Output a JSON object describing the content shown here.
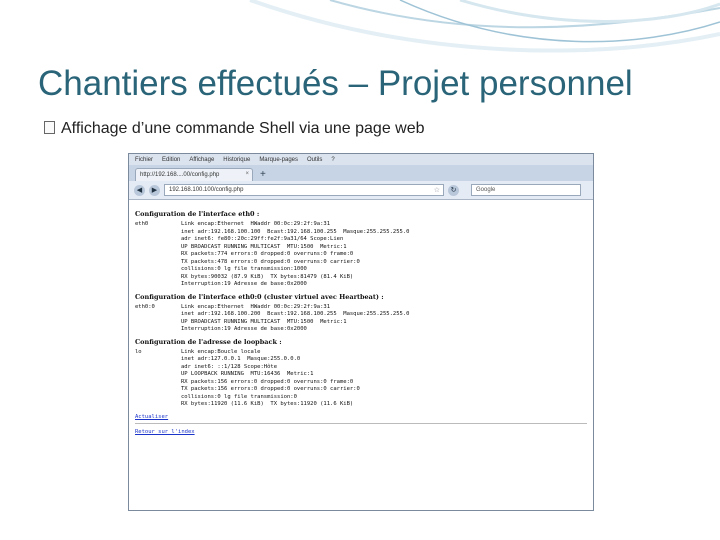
{
  "slide": {
    "title": "Chantiers effectués – Projet personnel",
    "bullet_text": "Affichage d’une commande Shell via une page web"
  },
  "browser": {
    "menu": [
      "Fichier",
      "Edition",
      "Affichage",
      "Historique",
      "Marque-pages",
      "Outils",
      "?"
    ],
    "tab_title": "http://192.168....00/config.php",
    "tab_close": "×",
    "new_tab": "+",
    "url": "192.168.100.100/config.php",
    "search_placeholder": "Google"
  },
  "page": {
    "sections": [
      {
        "heading": "Configuration de l'interface eth0 :",
        "iface": "eth0",
        "lines": [
          "Link encap:Ethernet  HWaddr 00:0c:29:2f:9a:31",
          "inet adr:192.168.100.100  Bcast:192.168.100.255  Masque:255.255.255.0",
          "adr inet6: fe80::20c:29ff:fe2f:9a31/64 Scope:Lien",
          "UP BROADCAST RUNNING MULTICAST  MTU:1500  Metric:1",
          "RX packets:774 errors:0 dropped:0 overruns:0 frame:0",
          "TX packets:478 errors:0 dropped:0 overruns:0 carrier:0",
          "collisions:0 lg file transmission:1000",
          "RX bytes:90032 (87.9 KiB)  TX bytes:81479 (81.4 KiB)",
          "Interruption:19 Adresse de base:0x2000"
        ]
      },
      {
        "heading": "Configuration de l'interface eth0:0 (cluster virtuel avec Heartbeat) :",
        "iface": "eth0:0",
        "lines": [
          "Link encap:Ethernet  HWaddr 00:0c:29:2f:9a:31",
          "inet adr:192.168.100.200  Bcast:192.168.100.255  Masque:255.255.255.0",
          "UP BROADCAST RUNNING MULTICAST  MTU:1500  Metric:1",
          "Interruption:19 Adresse de base:0x2000"
        ]
      },
      {
        "heading": "Configuration de l'adresse de loopback :",
        "iface": "lo",
        "lines": [
          "Link encap:Boucle locale",
          "inet adr:127.0.0.1  Masque:255.0.0.0",
          "adr inet6: ::1/128 Scope:Hôte",
          "UP LOOPBACK RUNNING  MTU:16436  Metric:1",
          "RX packets:156 errors:0 dropped:0 overruns:0 frame:0",
          "TX packets:156 errors:0 dropped:0 overruns:0 carrier:0",
          "collisions:0 lg file transmission:0",
          "RX bytes:11920 (11.6 KiB)  TX bytes:11920 (11.6 KiB)"
        ]
      }
    ],
    "link_1": "Actualiser",
    "link_2": "Retour sur l'index"
  }
}
